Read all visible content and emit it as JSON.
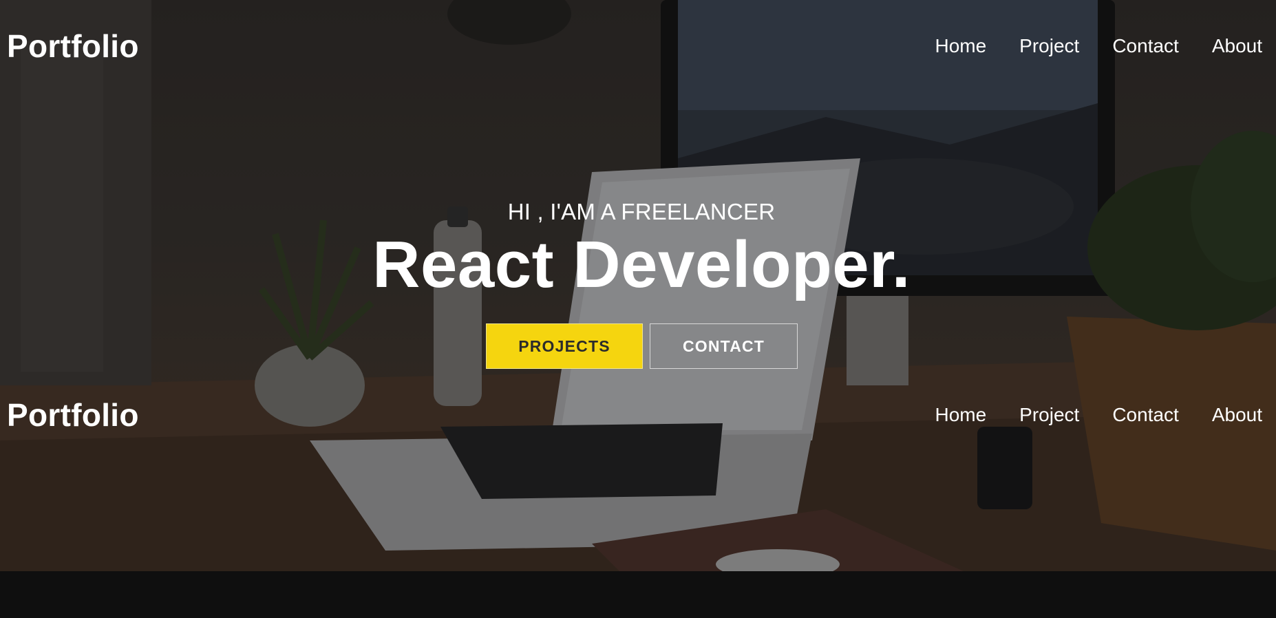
{
  "brand": {
    "logo": "Portfolio"
  },
  "nav": {
    "links": [
      {
        "label": "Home"
      },
      {
        "label": "Project"
      },
      {
        "label": "Contact"
      },
      {
        "label": "About"
      }
    ]
  },
  "hero": {
    "subtitle": "HI , I'AM A FREELANCER",
    "headline": "React Developer.",
    "buttons": {
      "projects": "PROJECTS",
      "contact": "CONTACT"
    },
    "background_image": "desk-with-laptop-monitor-plant-photo"
  },
  "second_nav": {
    "logo": "Portfolio",
    "links": [
      {
        "label": "Home"
      },
      {
        "label": "Project"
      },
      {
        "label": "Contact"
      },
      {
        "label": "About"
      }
    ]
  },
  "colors": {
    "accent": "#f5d50f",
    "text": "#ffffff",
    "footer_bg": "#0f0f0f"
  }
}
